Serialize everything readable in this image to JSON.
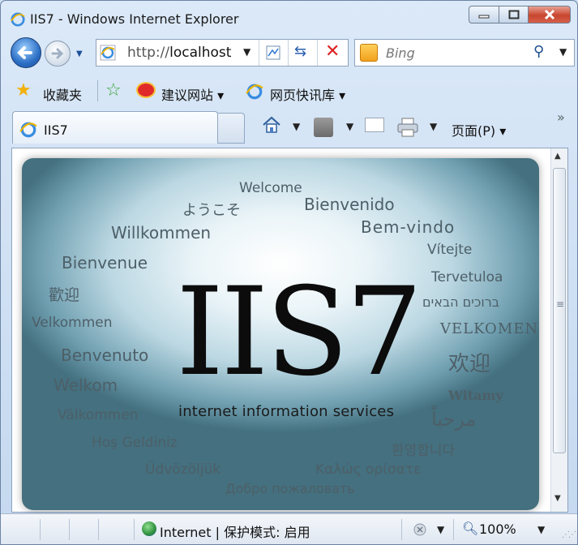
{
  "window": {
    "title": "IIS7 - Windows Internet Explorer"
  },
  "address_bar": {
    "url_prefix": "http://",
    "url_host": "localhost"
  },
  "search": {
    "placeholder": "Bing"
  },
  "favorites_bar": {
    "favorites_label": "收藏夹",
    "items": [
      {
        "label": "建议网站 ▾",
        "icon": "weibo-icon"
      },
      {
        "label": "网页快讯库 ▾",
        "icon": "ie-icon"
      }
    ]
  },
  "tabs": [
    {
      "label": "IIS7"
    }
  ],
  "command_bar": {
    "page_label": "页面(P) ▾"
  },
  "content": {
    "logo": "IIS7",
    "subtitle": "internet information services",
    "welcome_words": [
      "Welcome",
      "ようこそ",
      "Bienvenido",
      "Willkommen",
      "Bem-vindo",
      "Vítejte",
      "Bienvenue",
      "Tervetuloa",
      "歡迎",
      "ברוכים הבאים",
      "Velkommen",
      "VELKOMEN",
      "Benvenuto",
      "欢迎",
      "Welkom",
      "Witamy",
      "Välkommen",
      "مرحباً",
      "Hoş Geldiniz",
      "환영합니다",
      "Üdvözöljük",
      "Καλώς ορίσατε",
      "Добро пожаловать"
    ]
  },
  "status_bar": {
    "zone_text": "Internet | 保护模式: 启用",
    "zoom": "100%"
  },
  "colors": {
    "frame": "#c4d8ef",
    "close_button": "#c7462f",
    "banner_edge": "#44707f"
  }
}
